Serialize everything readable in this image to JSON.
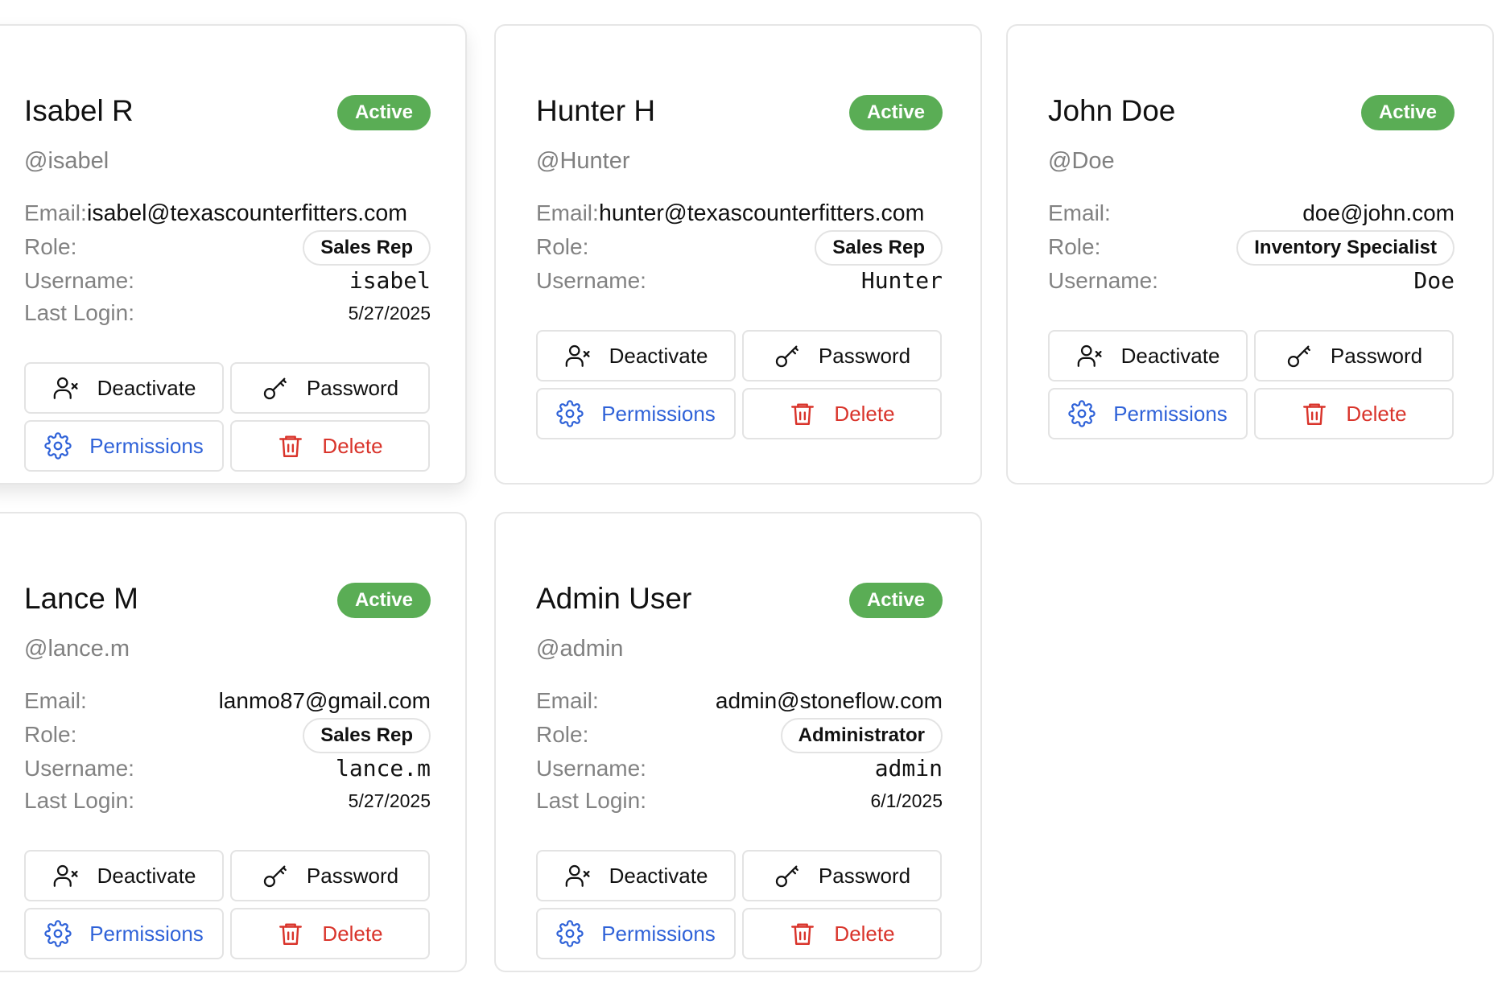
{
  "users": [
    {
      "name": "Isabel R",
      "status": "Active",
      "handle": "@isabel",
      "email_label": "Email:",
      "email": "isabel@texascounterfitters.com",
      "role_label": "Role:",
      "role": "Sales Rep",
      "username_label": "Username:",
      "username": "isabel",
      "last_login_label": "Last Login:",
      "last_login": "5/27/2025",
      "actions": {
        "deactivate": "Deactivate",
        "password": "Password",
        "permissions": "Permissions",
        "delete": "Delete"
      }
    },
    {
      "name": "Hunter H",
      "status": "Active",
      "handle": "@Hunter",
      "email_label": "Email:",
      "email": "hunter@texascounterfitters.com",
      "role_label": "Role:",
      "role": "Sales Rep",
      "username_label": "Username:",
      "username": "Hunter",
      "actions": {
        "deactivate": "Deactivate",
        "password": "Password",
        "permissions": "Permissions",
        "delete": "Delete"
      }
    },
    {
      "name": "John Doe",
      "status": "Active",
      "handle": "@Doe",
      "email_label": "Email:",
      "email": "doe@john.com",
      "role_label": "Role:",
      "role": "Inventory Specialist",
      "username_label": "Username:",
      "username": "Doe",
      "actions": {
        "deactivate": "Deactivate",
        "password": "Password",
        "permissions": "Permissions",
        "delete": "Delete"
      }
    },
    {
      "name": "Lance M",
      "status": "Active",
      "handle": "@lance.m",
      "email_label": "Email:",
      "email": "lanmo87@gmail.com",
      "role_label": "Role:",
      "role": "Sales Rep",
      "username_label": "Username:",
      "username": "lance.m",
      "last_login_label": "Last Login:",
      "last_login": "5/27/2025",
      "actions": {
        "deactivate": "Deactivate",
        "password": "Password",
        "permissions": "Permissions",
        "delete": "Delete"
      }
    },
    {
      "name": "Admin User",
      "status": "Active",
      "handle": "@admin",
      "email_label": "Email:",
      "email": "admin@stoneflow.com",
      "role_label": "Role:",
      "role": "Administrator",
      "username_label": "Username:",
      "username": "admin",
      "last_login_label": "Last Login:",
      "last_login": "6/1/2025",
      "actions": {
        "deactivate": "Deactivate",
        "password": "Password",
        "permissions": "Permissions",
        "delete": "Delete"
      }
    }
  ],
  "icons": {
    "deactivate": "user-x-icon",
    "password": "key-icon",
    "permissions": "gear-icon",
    "delete": "trash-icon"
  },
  "colors": {
    "status_active": "#5aad55",
    "permissions": "#2f62d8",
    "delete": "#d9342b",
    "border": "#e3e3e3",
    "muted_text": "#828282"
  }
}
